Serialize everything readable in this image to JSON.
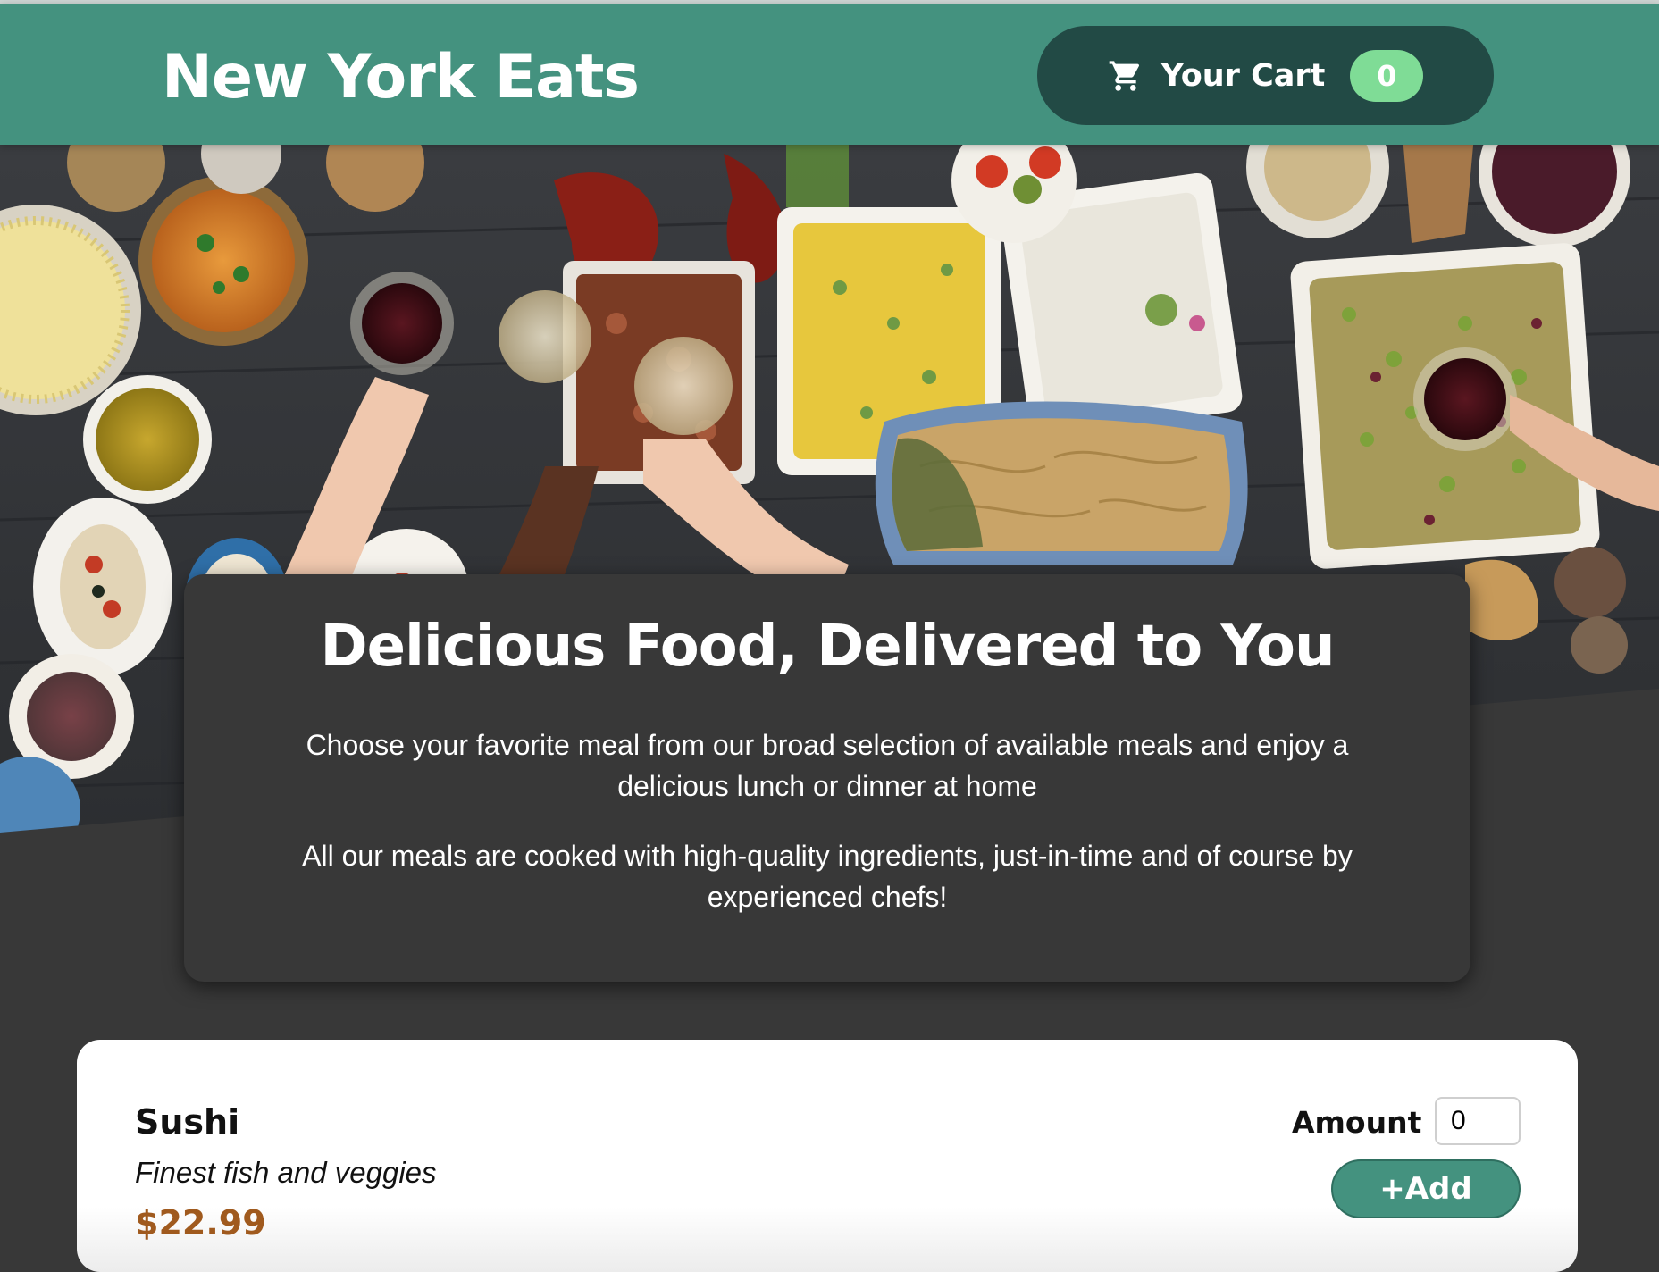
{
  "header": {
    "brand": "New York Eats",
    "cart_label": "Your Cart",
    "cart_count": "0"
  },
  "summary": {
    "title": "Delicious Food, Delivered to You",
    "paragraph1": "Choose your favorite meal from our broad selection of available meals and enjoy a delicious lunch or dinner at home",
    "paragraph2": "All our meals are cooked with high-quality ingredients, just-in-time and of course by experienced chefs!"
  },
  "meals": [
    {
      "name": "Sushi",
      "description": "Finest fish and veggies",
      "price": "$22.99",
      "amount_label": "Amount",
      "amount_value": "0",
      "add_label": "+Add"
    }
  ],
  "colors": {
    "header_bg": "#44927f",
    "cart_button_bg": "#224a45",
    "badge_bg": "#7fdc96",
    "page_bg": "#383838",
    "price": "#a05a1e"
  },
  "icons": {
    "cart": "shopping-cart-icon"
  }
}
